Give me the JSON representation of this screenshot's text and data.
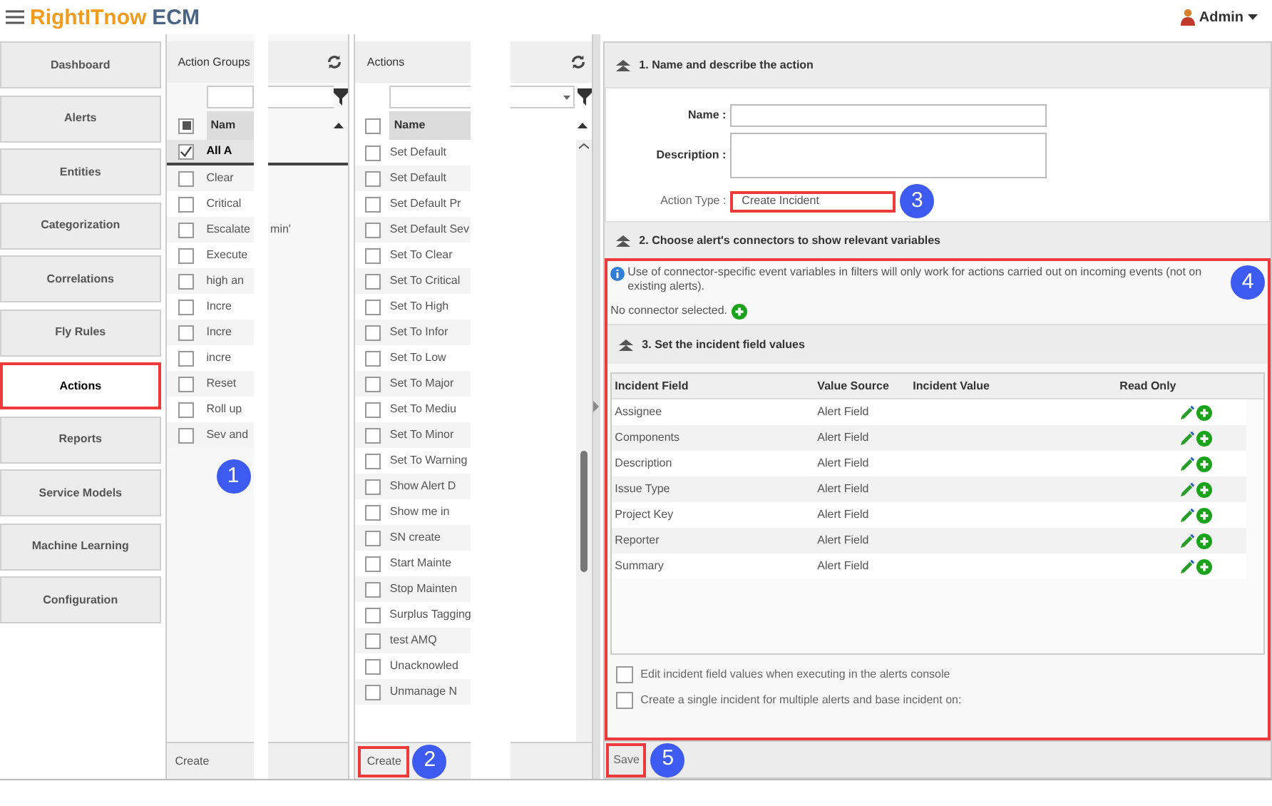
{
  "header": {
    "logo_brand": "RightITnow",
    "logo_product": "ECM",
    "user": "Admin"
  },
  "nav": [
    {
      "label": "Dashboard",
      "selected": false
    },
    {
      "label": "Alerts",
      "selected": false
    },
    {
      "label": "Entities",
      "selected": false
    },
    {
      "label": "Categorization",
      "selected": false
    },
    {
      "label": "Correlations",
      "selected": false
    },
    {
      "label": "Fly Rules",
      "selected": false
    },
    {
      "label": "Actions",
      "selected": true
    },
    {
      "label": "Reports",
      "selected": false
    },
    {
      "label": "Service Models",
      "selected": false
    },
    {
      "label": "Machine Learning",
      "selected": false
    },
    {
      "label": "Configuration",
      "selected": false
    }
  ],
  "action_groups": {
    "title": "Action Groups",
    "column": "Nam",
    "header_indeterminate": true,
    "footer_create": "Create",
    "items": [
      {
        "name": "All A",
        "checked": true,
        "selected": true
      },
      {
        "name": "Clear",
        "checked": false,
        "selected": false
      },
      {
        "name": "Critical",
        "checked": false,
        "selected": false
      },
      {
        "name": "Escalate",
        "continuation": "min'",
        "checked": false,
        "selected": false
      },
      {
        "name": "Execute",
        "checked": false,
        "selected": false
      },
      {
        "name": "high an",
        "checked": false,
        "selected": false
      },
      {
        "name": "Incre",
        "checked": false,
        "selected": false
      },
      {
        "name": "Incre",
        "checked": false,
        "selected": false
      },
      {
        "name": "incre",
        "checked": false,
        "selected": false
      },
      {
        "name": "Reset",
        "checked": false,
        "selected": false
      },
      {
        "name": "Roll up",
        "checked": false,
        "selected": false
      },
      {
        "name": "Sev and",
        "checked": false,
        "selected": false
      }
    ]
  },
  "actions": {
    "title": "Actions",
    "column": "Name",
    "header_checked": false,
    "footer_create": "Create",
    "create_highlighted": true,
    "items": [
      {
        "name": "Set Default",
        "checked": false
      },
      {
        "name": "Set Default",
        "checked": false
      },
      {
        "name": "Set Default Pr",
        "checked": false
      },
      {
        "name": "Set Default Sev",
        "checked": false
      },
      {
        "name": "Set To Clear",
        "checked": false
      },
      {
        "name": "Set To Critical",
        "checked": false
      },
      {
        "name": "Set To High",
        "checked": false
      },
      {
        "name": "Set To Infor",
        "checked": false
      },
      {
        "name": "Set To Low",
        "checked": false
      },
      {
        "name": "Set To Major",
        "checked": false
      },
      {
        "name": "Set To Mediu",
        "checked": false
      },
      {
        "name": "Set To Minor",
        "checked": false
      },
      {
        "name": "Set To Warning",
        "checked": false
      },
      {
        "name": "Show Alert D",
        "checked": false
      },
      {
        "name": "Show me in",
        "checked": false
      },
      {
        "name": "SN create",
        "checked": false
      },
      {
        "name": "Start Mainte",
        "checked": false
      },
      {
        "name": "Stop Mainten",
        "checked": false
      },
      {
        "name": "Surplus Tagging",
        "checked": false
      },
      {
        "name": "test AMQ",
        "checked": false
      },
      {
        "name": "Unacknowled",
        "checked": false
      },
      {
        "name": "Unmanage N",
        "checked": false
      }
    ]
  },
  "editor": {
    "section1": "1. Name and describe the action",
    "name_label": "Name :",
    "description_label": "Description :",
    "action_type_label": "Action Type :",
    "action_type": "Create Incident",
    "action_type_highlighted": true,
    "section2": "2. Choose alert's connectors to show relevant variables",
    "connectors_highlighted": true,
    "info": "Use of connector-specific event variables in filters will only work for actions carried out on incoming events (not on existing alerts).",
    "no_connector": "No connector selected.",
    "section3": "3. Set the incident field values",
    "columns": [
      "Incident Field",
      "Value Source",
      "Incident Value",
      "Read Only"
    ],
    "rows": [
      {
        "field": "Assignee",
        "source": "Alert Field"
      },
      {
        "field": "Components",
        "source": "Alert Field"
      },
      {
        "field": "Description",
        "source": "Alert Field"
      },
      {
        "field": "Issue Type",
        "source": "Alert Field"
      },
      {
        "field": "Project Key",
        "source": "Alert Field"
      },
      {
        "field": "Reporter",
        "source": "Alert Field"
      },
      {
        "field": "Summary",
        "source": "Alert Field"
      }
    ],
    "options": [
      {
        "label": "Edit incident field values when executing in the alerts console",
        "checked": false
      },
      {
        "label": "Create a single incident for multiple alerts and base incident on:",
        "checked": false
      }
    ],
    "save": "Save",
    "save_highlighted": true
  },
  "callouts": [
    "1",
    "2",
    "3",
    "4",
    "5"
  ]
}
